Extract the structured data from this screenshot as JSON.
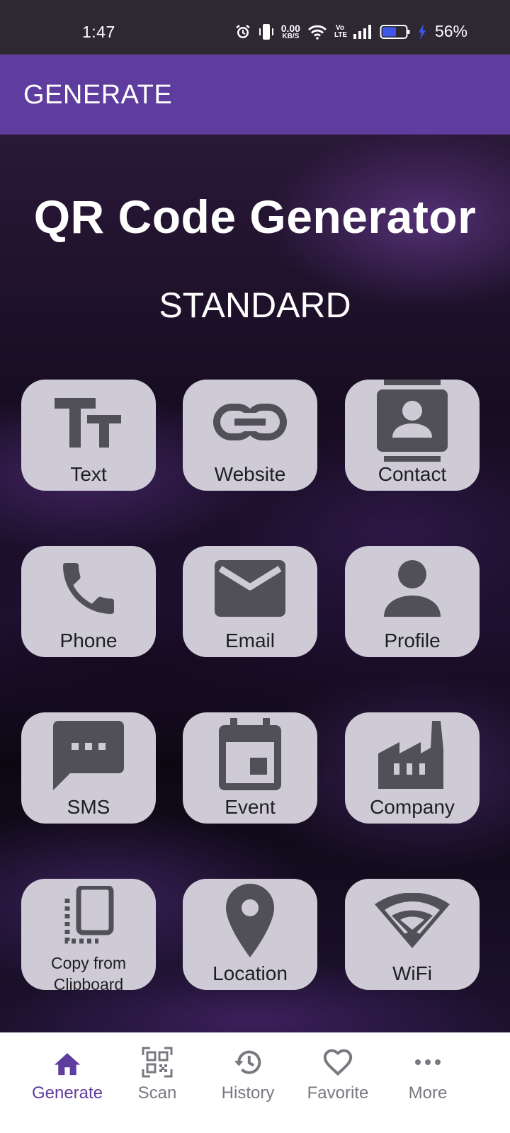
{
  "status_bar": {
    "time": "1:47",
    "net_speed_value": "0.00",
    "net_speed_unit": "KB/S",
    "volte": "Vo LTE",
    "battery_percent": "56%",
    "icons": [
      "alarm-icon",
      "vibrate-icon",
      "wifi-icon",
      "volte-icon",
      "signal-icon",
      "battery-icon",
      "charging-icon"
    ]
  },
  "app_bar": {
    "title": "GENERATE",
    "color": "#5f3d9e"
  },
  "main": {
    "title": "QR Code Generator",
    "section": "STANDARD",
    "tiles": [
      {
        "label": "Text",
        "icon": "text-icon"
      },
      {
        "label": "Website",
        "icon": "link-icon"
      },
      {
        "label": "Contact",
        "icon": "contact-icon"
      },
      {
        "label": "Phone",
        "icon": "phone-icon"
      },
      {
        "label": "Email",
        "icon": "email-icon"
      },
      {
        "label": "Profile",
        "icon": "profile-icon"
      },
      {
        "label": "SMS",
        "icon": "sms-icon"
      },
      {
        "label": "Event",
        "icon": "calendar-icon"
      },
      {
        "label": "Company",
        "icon": "factory-icon"
      },
      {
        "label": "Copy from Clipboard",
        "icon": "clipboard-icon"
      },
      {
        "label": "Location",
        "icon": "location-pin-icon"
      },
      {
        "label": "WiFi",
        "icon": "wifi-icon"
      }
    ]
  },
  "bottom_nav": {
    "items": [
      {
        "label": "Generate",
        "icon": "home-icon",
        "active": true
      },
      {
        "label": "Scan",
        "icon": "qr-scan-icon",
        "active": false
      },
      {
        "label": "History",
        "icon": "history-icon",
        "active": false
      },
      {
        "label": "Favorite",
        "icon": "heart-icon",
        "active": false
      },
      {
        "label": "More",
        "icon": "more-dots-icon",
        "active": false
      }
    ],
    "active_color": "#5f3d9e",
    "inactive_color": "#7a7880"
  }
}
